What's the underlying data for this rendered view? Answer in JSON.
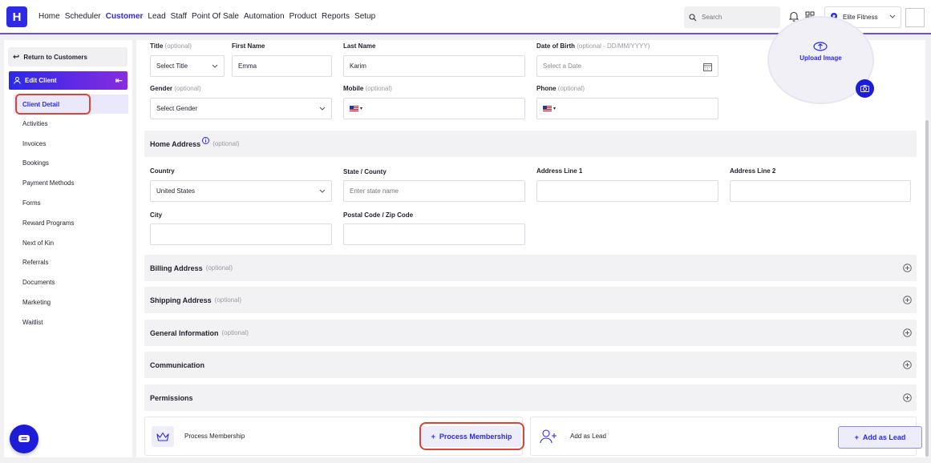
{
  "brand": {
    "logo_letter": "H",
    "accent": "#2d2be8"
  },
  "nav": {
    "links": [
      {
        "label": "Home"
      },
      {
        "label": "Scheduler"
      },
      {
        "label": "Customer",
        "active": true
      },
      {
        "label": "Lead"
      },
      {
        "label": "Staff"
      },
      {
        "label": "Point Of Sale"
      },
      {
        "label": "Automation"
      },
      {
        "label": "Product"
      },
      {
        "label": "Reports"
      },
      {
        "label": "Setup"
      }
    ],
    "search_placeholder": "Search",
    "location": "Elite Fitness"
  },
  "sidebar": {
    "return_label": "Return to Customers",
    "edit_client_label": "Edit Client",
    "items": [
      {
        "label": "Client Detail",
        "active": true
      },
      {
        "label": "Activities"
      },
      {
        "label": "Invoices"
      },
      {
        "label": "Bookings"
      },
      {
        "label": "Payment Methods"
      },
      {
        "label": "Forms"
      },
      {
        "label": "Reward Programs"
      },
      {
        "label": "Next of Kin"
      },
      {
        "label": "Referrals"
      },
      {
        "label": "Documents"
      },
      {
        "label": "Marketing"
      },
      {
        "label": "Waitlist"
      }
    ]
  },
  "form": {
    "title": {
      "label": "Title",
      "optional": "(optional)",
      "value": "Select Title"
    },
    "first_name": {
      "label": "First Name",
      "value": "Emma"
    },
    "last_name": {
      "label": "Last Name",
      "value": "Karim"
    },
    "dob": {
      "label": "Date of Birth",
      "optional": "(optional - DD/MM/YYYY)",
      "placeholder": "Select a Date"
    },
    "gender": {
      "label": "Gender",
      "optional": "(optional)",
      "value": "Select Gender"
    },
    "mobile": {
      "label": "Mobile",
      "optional": "(optional)",
      "value": ""
    },
    "phone": {
      "label": "Phone",
      "optional": "(optional)",
      "value": ""
    },
    "upload_label": "Upload Image",
    "home_address": {
      "heading": "Home Address",
      "optional": "(optional)",
      "country": {
        "label": "Country",
        "value": "United States"
      },
      "state": {
        "label": "State / County",
        "placeholder": "Enter state name"
      },
      "address1": {
        "label": "Address Line 1",
        "value": ""
      },
      "address2": {
        "label": "Address Line 2",
        "value": ""
      },
      "city": {
        "label": "City",
        "value": ""
      },
      "postal": {
        "label": "Postal Code / Zip Code",
        "value": ""
      }
    },
    "sections": [
      {
        "title": "Billing Address",
        "optional": "(optional)"
      },
      {
        "title": "Shipping Address",
        "optional": "(optional)"
      },
      {
        "title": "General Information",
        "optional": "(optional)"
      },
      {
        "title": "Communication",
        "optional": ""
      },
      {
        "title": "Permissions",
        "optional": ""
      }
    ]
  },
  "cards": {
    "membership": {
      "title": "Process Membership",
      "button": "Process Membership"
    },
    "lead": {
      "title": "Add as Lead",
      "button": "Add as Lead"
    }
  }
}
